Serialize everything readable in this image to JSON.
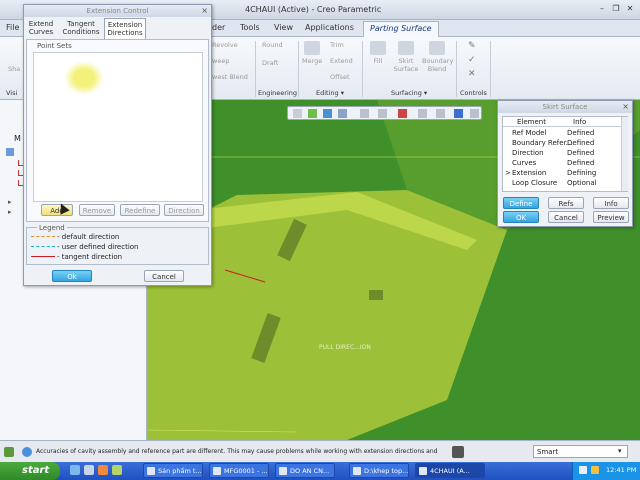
{
  "app": {
    "title": "4CHAUI (Active) - Creo Parametric"
  },
  "window_buttons": [
    "–",
    "❐",
    "✕"
  ],
  "ribbon": {
    "file_tab": "File",
    "tabs": [
      "der",
      "Tools",
      "View",
      "Applications",
      "Parting Surface"
    ],
    "active_tab": "Parting Surface",
    "items": [
      {
        "label": "Revolve"
      },
      {
        "label": "weep"
      },
      {
        "label": "west Blend"
      },
      {
        "label": "Round"
      },
      {
        "label": "Draft"
      },
      {
        "label": "Merge"
      },
      {
        "label": "Trim"
      },
      {
        "label": "Extend"
      },
      {
        "label": "Offset"
      },
      {
        "label": "Fill"
      },
      {
        "label": "Skirt Surface"
      },
      {
        "label": "Boundary Blend"
      }
    ],
    "groups": [
      "Visi",
      "Engineering",
      "Editing ▾",
      "Surfacing ▾",
      "Controls"
    ]
  },
  "left_panel": {
    "label_s": "Sha",
    "label_m": "M"
  },
  "extension_control": {
    "title": "Extension Control",
    "tabs": [
      "Extend Curves",
      "Tangent Conditions",
      "Extension Directions"
    ],
    "active_tab": "Extension Directions",
    "point_sets_label": "Point Sets",
    "buttons": {
      "add": "Add",
      "remove": "Remove",
      "redefine": "Redefine",
      "direction": "Direction"
    },
    "legend_label": "Legend",
    "legend": [
      {
        "text": "- default direction",
        "color": "#e08a1a"
      },
      {
        "text": "- user defined direction",
        "color": "#1ab0c8"
      },
      {
        "text": "- tangent direction",
        "color": "#d11a1a"
      }
    ],
    "ok": "Ok",
    "cancel": "Cancel"
  },
  "skirt_surface": {
    "title": "Skirt Surface",
    "columns": [
      "Element",
      "Info"
    ],
    "rows": [
      {
        "element": "Ref Model",
        "info": "Defined",
        "marker": ""
      },
      {
        "element": "Boundary Refer...",
        "info": "Defined",
        "marker": ""
      },
      {
        "element": "Direction",
        "info": "Defined",
        "marker": ""
      },
      {
        "element": "Curves",
        "info": "Defined",
        "marker": ""
      },
      {
        "element": "Extension",
        "info": "Defining",
        "marker": ">"
      },
      {
        "element": "Loop Closure",
        "info": "Optional",
        "marker": ""
      }
    ],
    "buttons": {
      "define": "Define",
      "refs": "Refs",
      "info": "Info",
      "ok": "OK",
      "cancel": "Cancel",
      "preview": "Preview"
    }
  },
  "viewport": {
    "pull_direction_label": "PULL DIREC...ION"
  },
  "status": {
    "message": "Accuracies of cavity assembly and reference part are different. This may  cause problems while working with extension directions and",
    "filter": "Smart"
  },
  "taskbar": {
    "start": "start",
    "tasks": [
      "Sản phẩm t...",
      "MFG0001 - ...",
      "DO AN CN...",
      "D:\\khep top...",
      "4CHAUI (A..."
    ],
    "active_task": "4CHAUI (A...",
    "clock": "12:41 PM"
  },
  "colors": {
    "viewport_green": "#3f8f2a",
    "part_yellow_green": "#a4c43a",
    "accent_blue": "#33a4e0"
  }
}
